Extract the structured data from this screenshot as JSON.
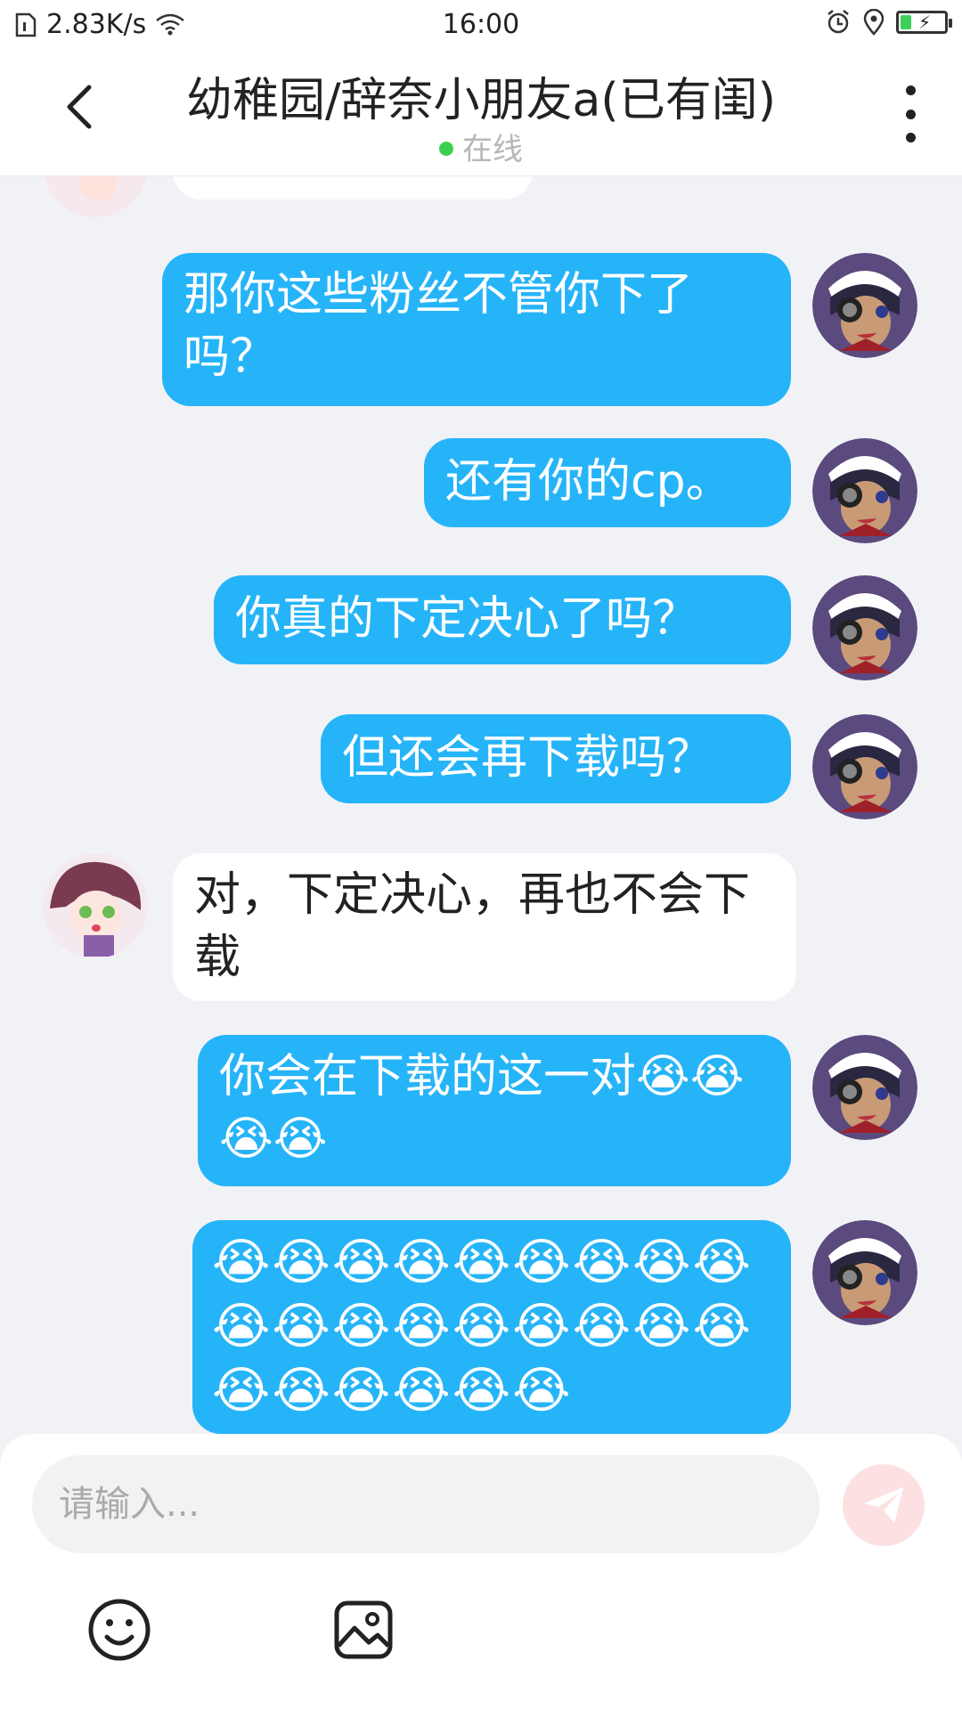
{
  "status_bar": {
    "speed": "2.83K/s",
    "time": "16:00",
    "icons": [
      "sim-icon",
      "wifi-icon",
      "alarm-icon",
      "location-icon",
      "battery-charging-icon"
    ]
  },
  "header": {
    "title": "幼稚园/辞奈小朋友a(已有闺)",
    "presence": "在线",
    "presence_color": "#3fcf4f",
    "icons": [
      "back-icon",
      "more-icon"
    ]
  },
  "chat": {
    "me_color": "#26b4f9",
    "them_color": "#ffffff",
    "messages": [
      {
        "from": "them",
        "text": ""
      },
      {
        "from": "me",
        "text": "那你这些粉丝不管你下了吗？"
      },
      {
        "from": "me",
        "text": "还有你的cp。"
      },
      {
        "from": "me",
        "text": "你真的下定决心了吗？"
      },
      {
        "from": "me",
        "text": "但还会再下载吗？"
      },
      {
        "from": "them",
        "text": "对，下定决心，再也不会下载"
      },
      {
        "from": "me",
        "text": "你会在下载的这一对😭😭😭😭"
      },
      {
        "from": "me",
        "text": "😭😭😭😭😭😭😭😭😭😭😭😭😭😭😭😭😭😭😭😭😭😭😭😭"
      }
    ]
  },
  "composer": {
    "placeholder": "请输入...",
    "icons": [
      "send-icon",
      "emoji-icon",
      "image-icon"
    ]
  }
}
